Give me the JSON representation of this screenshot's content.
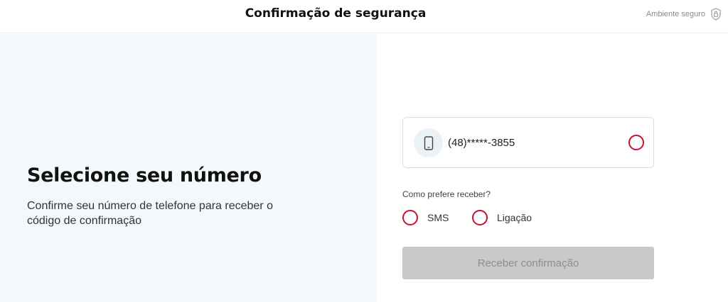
{
  "header": {
    "title": "Confirmação de segurança",
    "secure_label": "Ambiente seguro",
    "secure_icon": "lock-shield-icon"
  },
  "intro": {
    "heading": "Selecione seu número",
    "description": "Confirme seu número de telefone para receber o código de confirmação"
  },
  "phone_option": {
    "icon": "smartphone-icon",
    "number": "(48)*****-3855",
    "selected": false
  },
  "delivery": {
    "question": "Como prefere receber?",
    "options": [
      {
        "label": "SMS",
        "selected": false
      },
      {
        "label": "Ligação",
        "selected": false
      }
    ]
  },
  "submit": {
    "label": "Receber confirmação",
    "enabled": false
  },
  "colors": {
    "accent": "#c8102e",
    "left_panel_bg": "#f3f8fa",
    "disabled_button_bg": "#c9c9c9"
  }
}
